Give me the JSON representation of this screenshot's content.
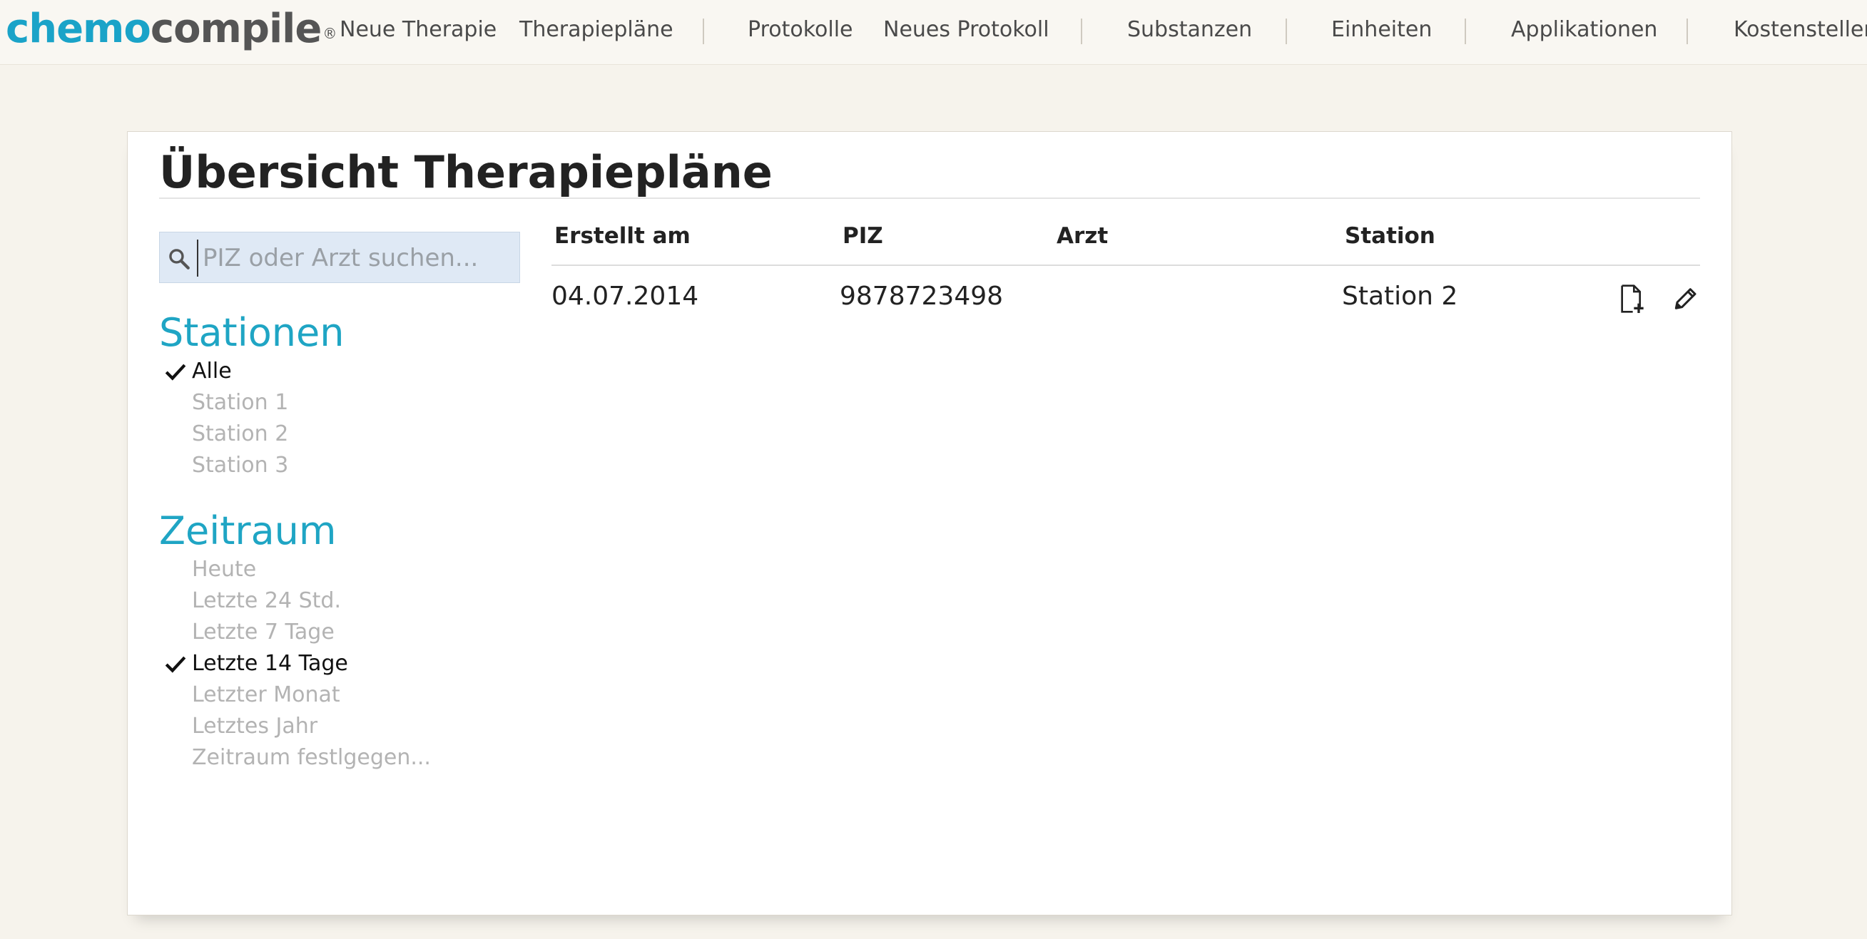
{
  "app": {
    "logo_part1": "chemo",
    "logo_part2": "compile",
    "logo_mark": "®"
  },
  "nav": {
    "items": [
      {
        "label": "Neue Therapie"
      },
      {
        "label": "Therapiepläne"
      },
      {
        "label": "Protokolle"
      },
      {
        "label": "Neues Protokoll"
      },
      {
        "label": "Substanzen"
      },
      {
        "label": "Einheiten"
      },
      {
        "label": "Applikationen"
      },
      {
        "label": "Kostenstellen"
      }
    ]
  },
  "page": {
    "title": "Übersicht Therapiepläne"
  },
  "search": {
    "placeholder": "PIZ oder Arzt suchen...",
    "value": "",
    "icon": "search-icon"
  },
  "filters": {
    "stationen": {
      "heading": "Stationen",
      "items": [
        {
          "label": "Alle",
          "selected": true
        },
        {
          "label": "Station 1",
          "selected": false
        },
        {
          "label": "Station 2",
          "selected": false
        },
        {
          "label": "Station 3",
          "selected": false
        }
      ]
    },
    "zeitraum": {
      "heading": "Zeitraum",
      "items": [
        {
          "label": "Heute",
          "selected": false
        },
        {
          "label": "Letzte 24 Std.",
          "selected": false
        },
        {
          "label": "Letzte 7 Tage",
          "selected": false
        },
        {
          "label": "Letzte 14 Tage",
          "selected": true
        },
        {
          "label": "Letzter Monat",
          "selected": false
        },
        {
          "label": "Letztes Jahr",
          "selected": false
        },
        {
          "label": "Zeitraum festlgegen...",
          "selected": false
        }
      ]
    }
  },
  "table": {
    "columns": [
      "Erstellt am",
      "PIZ",
      "Arzt",
      "Station"
    ],
    "rows": [
      {
        "erstellt_am": "04.07.2014",
        "piz": "9878723498",
        "arzt": "",
        "station": "Station 2",
        "actions": [
          "new-document-icon",
          "pencil-icon"
        ]
      }
    ]
  },
  "colors": {
    "accent": "#1fa5c4",
    "logo_blue": "#1aa3c8",
    "background": "#f6f3ec",
    "search_bg": "#dfe9f5"
  }
}
